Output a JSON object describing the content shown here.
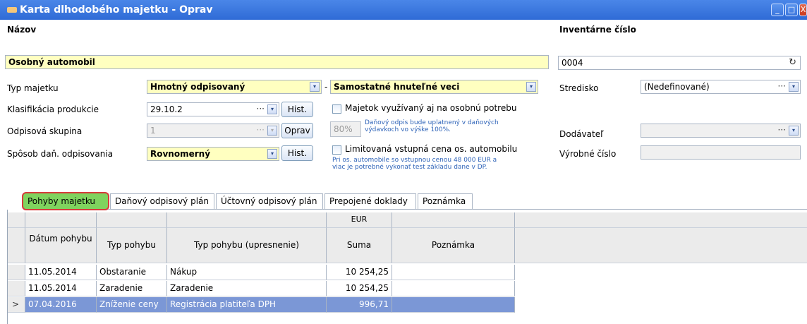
{
  "window": {
    "title": "Karta dlhodobého majetku - Oprav",
    "controls": [
      "_",
      "□",
      "X"
    ]
  },
  "form": {
    "nazov_label": "Názov",
    "nazov_value": "Osobný automobil",
    "inv_label": "Inventárne číslo",
    "inv_value": "0004",
    "refresh_icon": "↻",
    "typ_label": "Typ majetku",
    "typ_value": "Hmotný odpisovaný",
    "typ_dash": "-",
    "typ2_value": "Samostatné hnuteľné veci",
    "stredisko_label": "Stredisko",
    "stredisko_value": "(Nedefinované)",
    "klas_label": "Klasifikácia produkcie",
    "klas_value": "29.10.2",
    "hist_label": "Hist.",
    "osobna_label": "Majetok využívaný aj na osobnú potrebu",
    "odp_label": "Odpisová skupina",
    "odp_value": "1",
    "oprav_label": "Oprav",
    "pct_value": "80%",
    "pct_note_1": "Daňový odpis bude uplatnený v daňových",
    "pct_note_2": "výdavkoch vo výške 100%.",
    "dodavatel_label": "Dodávateľ",
    "sposob_label": "Spôsob daň. odpisovania",
    "sposob_value": "Rovnomerný",
    "limit_label": "Limitovaná vstupná cena os. automobilu",
    "limit_note_1": "Pri os. automobile so vstupnou cenou  48 000 EUR a",
    "limit_note_2": "viac je potrebné vykonať test základu dane v DP.",
    "vyrobne_label": "Výrobné číslo",
    "dots": "···",
    "dd_arrow": "▾"
  },
  "tabs": [
    {
      "label": "Pohyby majetku",
      "active": true
    },
    {
      "label": "Daňový odpisový plán"
    },
    {
      "label": "Účtovný odpisový plán"
    },
    {
      "label": "Prepojené doklady"
    },
    {
      "label": "Poznámka"
    }
  ],
  "table": {
    "currency": "EUR",
    "columns": [
      "Dátum pohybu",
      "Typ pohybu",
      "Typ pohybu (upresnenie)",
      "Suma",
      "Poznámka"
    ],
    "rows": [
      {
        "datum": "11.05.2014",
        "typ": "Obstaranie",
        "upresnenie": "Nákup",
        "suma": "10 254,25",
        "poznamka": ""
      },
      {
        "datum": "11.05.2014",
        "typ": "Zaradenie",
        "upresnenie": "Zaradenie",
        "suma": "10 254,25",
        "poznamka": ""
      },
      {
        "datum": "07.04.2016",
        "typ": "Zníženie ceny",
        "upresnenie": "Registrácia platiteľa DPH",
        "suma": "996,71",
        "poznamka": "",
        "selected": true
      }
    ],
    "row_pointer": ">"
  }
}
